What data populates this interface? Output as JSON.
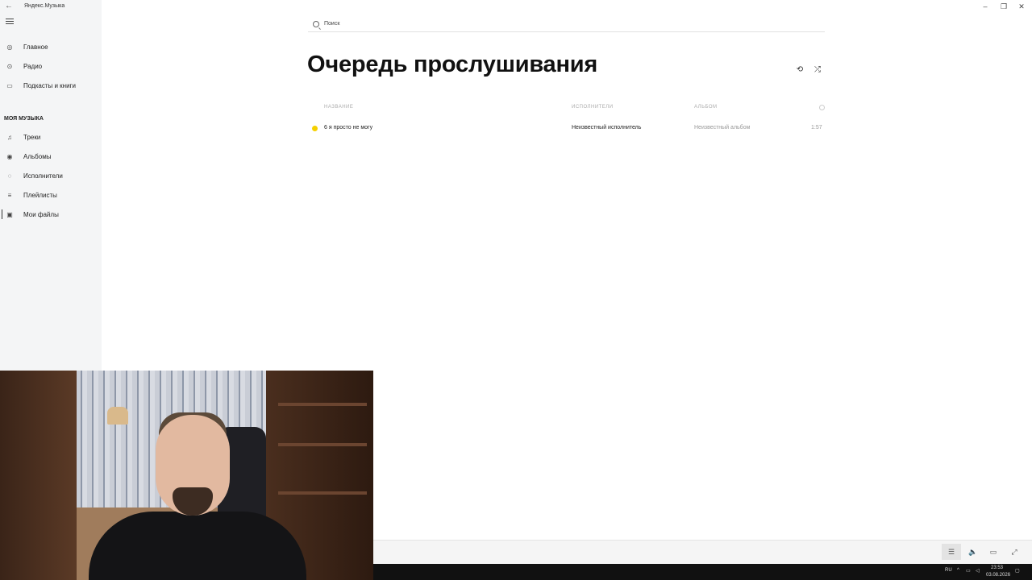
{
  "window": {
    "title": "Яндекс.Музыка",
    "back_icon": "arrow-left-icon",
    "controls": [
      "minimize-icon",
      "maximize-icon",
      "close-icon"
    ]
  },
  "sidebar": {
    "main_items": [
      {
        "label": "Главное",
        "icon": "home-icon"
      },
      {
        "label": "Радио",
        "icon": "radio-icon"
      },
      {
        "label": "Подкасты и книги",
        "icon": "podcast-icon"
      }
    ],
    "section_title": "МОЯ МУЗЫКА",
    "my_music_items": [
      {
        "label": "Треки",
        "icon": "note-icon"
      },
      {
        "label": "Альбомы",
        "icon": "album-icon"
      },
      {
        "label": "Исполнители",
        "icon": "artist-icon"
      },
      {
        "label": "Плейлисты",
        "icon": "playlist-icon"
      },
      {
        "label": "Мои файлы",
        "icon": "folder-icon",
        "active": true
      }
    ]
  },
  "search": {
    "placeholder": "Поиск"
  },
  "page": {
    "title": "Очередь прослушивания",
    "controls": [
      "repeat-icon",
      "shuffle-icon"
    ]
  },
  "table": {
    "headers": {
      "name": "НАЗВАНИЕ",
      "artist": "ИСПОЛНИТЕЛИ",
      "album": "АЛЬБОМ",
      "duration_icon": "clock-icon"
    },
    "rows": [
      {
        "name": "6 я просто не могу",
        "artist": "Неизвестный исполнитель",
        "album": "Неизвестный альбом",
        "duration": "1:57",
        "playing": true
      }
    ]
  },
  "player": {
    "buttons": [
      "queue-icon",
      "volume-icon",
      "mini-player-icon",
      "fullscreen-icon"
    ]
  },
  "taskbar": {
    "language": "RU",
    "time": "23:53",
    "date": "03.08.2026"
  }
}
